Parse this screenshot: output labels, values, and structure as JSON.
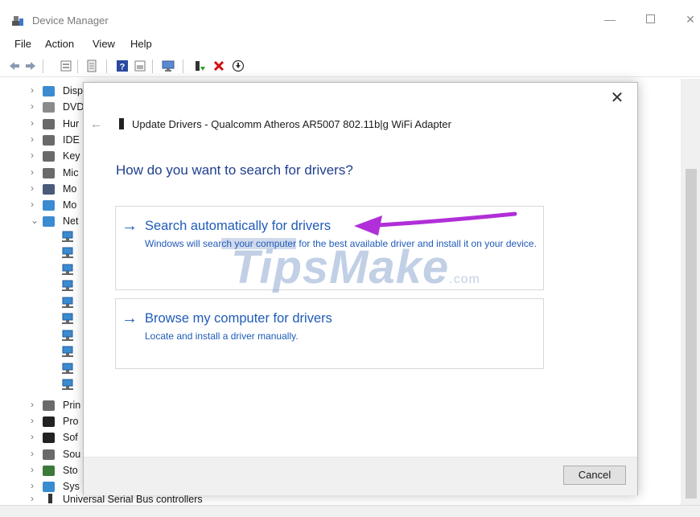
{
  "window": {
    "title": "Device Manager",
    "controls": {
      "minimize": "—",
      "maximize": "",
      "close": "✕"
    }
  },
  "menu": [
    "File",
    "Action",
    "View",
    "Help"
  ],
  "toolbar": {
    "icons": [
      "back-icon",
      "forward-icon",
      "properties-icon",
      "device-list-icon",
      "help-icon",
      "details-icon",
      "scan-hardware-icon",
      "update-driver-icon",
      "uninstall-icon",
      "disable-icon"
    ]
  },
  "tree": {
    "items": [
      {
        "label": "Disp",
        "icon": "display-adapters-icon",
        "color": "#3b8bd0",
        "expanded": false
      },
      {
        "label": "DVD",
        "icon": "dvd-drive-icon",
        "color": "#8a8a8a",
        "expanded": false
      },
      {
        "label": "Hur",
        "icon": "hid-icon",
        "color": "#6a6a6a",
        "expanded": false
      },
      {
        "label": "IDE",
        "icon": "ide-controller-icon",
        "color": "#6a6a6a",
        "expanded": false
      },
      {
        "label": "Key",
        "icon": "keyboard-icon",
        "color": "#6a6a6a",
        "expanded": false
      },
      {
        "label": "Mic",
        "icon": "mice-icon",
        "color": "#6a6a6a",
        "expanded": false
      },
      {
        "label": "Mo",
        "icon": "monitor-icon",
        "color": "#4a5a7a",
        "expanded": false
      },
      {
        "label": "Mo",
        "icon": "modem-icon",
        "color": "#3b8bd0",
        "expanded": false
      },
      {
        "label": "Net",
        "icon": "network-adapters-icon",
        "color": "#3b8bd0",
        "expanded": true
      }
    ],
    "network_children_count_label": "",
    "items_after": [
      {
        "label": "Prin",
        "icon": "print-queue-icon",
        "color": "#6a6a6a"
      },
      {
        "label": "Pro",
        "icon": "processor-icon",
        "color": "#222222"
      },
      {
        "label": "Sof",
        "icon": "software-device-icon",
        "color": "#222222"
      },
      {
        "label": "Sou",
        "icon": "sound-icon",
        "color": "#6a6a6a"
      },
      {
        "label": "Sto",
        "icon": "storage-icon",
        "color": "#3b7a3b"
      },
      {
        "label": "Sys",
        "icon": "system-devices-icon",
        "color": "#3b8bd0"
      }
    ],
    "last_row": "Universal Serial Bus controllers"
  },
  "dialog": {
    "title": "Update Drivers - Qualcomm Atheros AR5007 802.11b|g WiFi Adapter",
    "question": "How do you want to search for drivers?",
    "options": [
      {
        "title": "Search automatically for drivers",
        "desc_part1": "Windows will sear",
        "desc_highlight": "ch your computer",
        "desc_part2": " for the best available driver and install it on your device."
      },
      {
        "title": "Browse my computer for drivers",
        "desc": "Locate and install a driver manually."
      }
    ],
    "cancel_label": "Cancel",
    "close_glyph": "✕",
    "back_glyph": "←"
  },
  "watermark": {
    "text": "TipsMake",
    "suffix": ".com"
  },
  "colors": {
    "link_blue": "#1f5bb8",
    "heading_blue": "#1f3f8c",
    "annotation_arrow": "#b02fd8"
  }
}
